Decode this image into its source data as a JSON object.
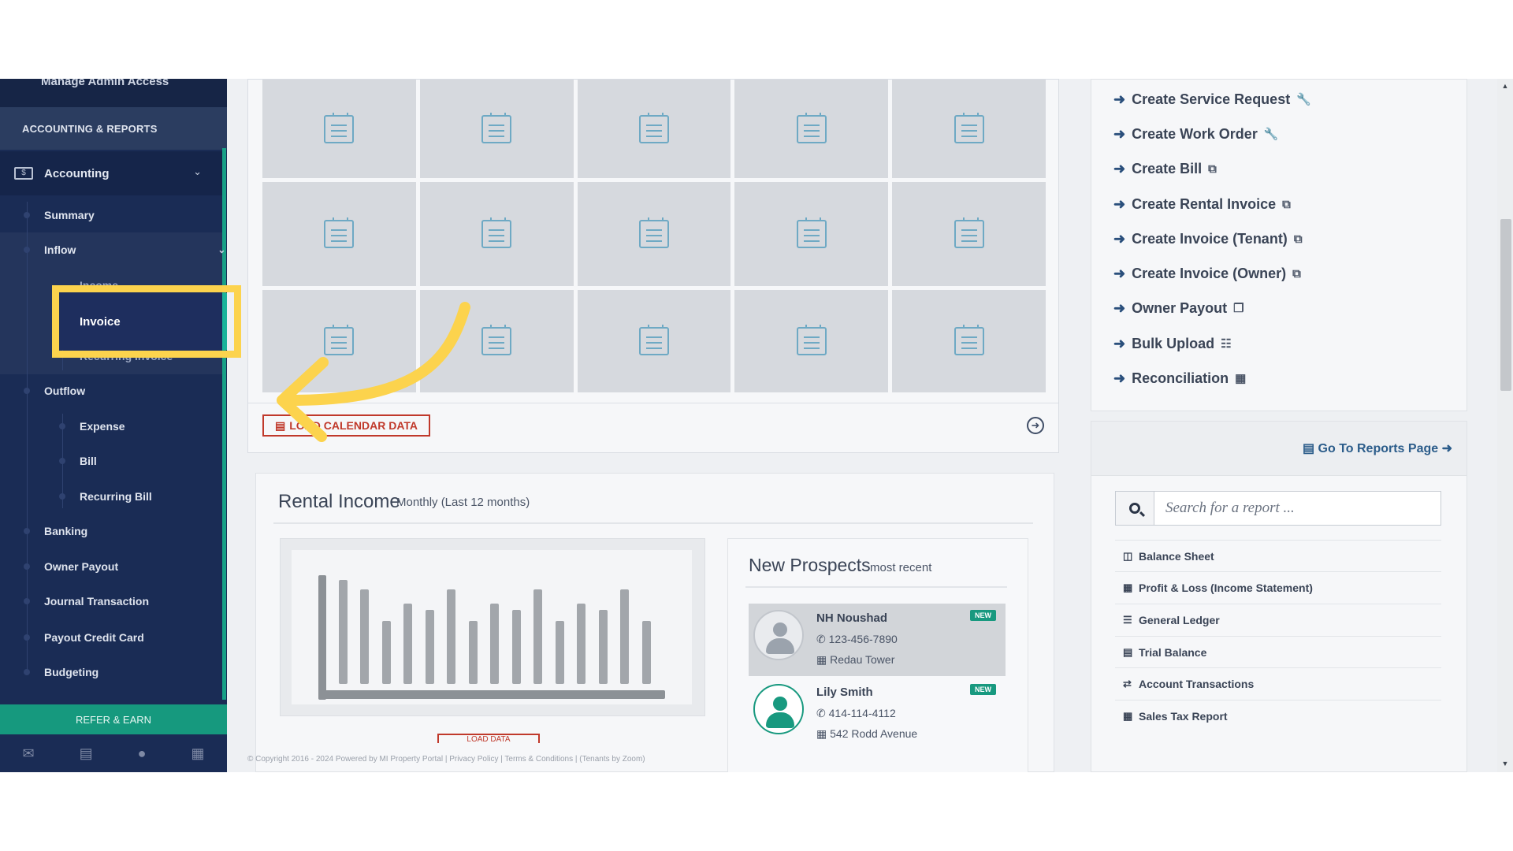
{
  "sidebar": {
    "top_item": "Manage Admin Access",
    "section_header": "ACCOUNTING & REPORTS",
    "accounting_label": "Accounting",
    "items": {
      "summary": "Summary",
      "inflow": "Inflow",
      "income": "Income",
      "invoice": "Invoice",
      "recurring_invoice": "Recurring Invoice",
      "outflow": "Outflow",
      "expense": "Expense",
      "bill": "Bill",
      "recurring_bill": "Recurring Bill",
      "banking": "Banking",
      "owner_payout": "Owner Payout",
      "journal_transaction": "Journal Transaction",
      "payout_credit_card": "Payout Credit Card",
      "budgeting": "Budgeting"
    },
    "refer_earn": "REFER & EARN",
    "footer_icons": [
      "envelope-icon",
      "briefcase-icon",
      "user-icon",
      "calculator-icon"
    ]
  },
  "calendar": {
    "load_button": "LOAD CALENDAR DATA"
  },
  "rental_income": {
    "title": "Rental Income",
    "subtitle": "Monthly (Last 12 months)",
    "load_stub": "LOAD DATA"
  },
  "prospects": {
    "title": "New Prospects",
    "subtitle": "most recent",
    "badge": "NEW",
    "list": [
      {
        "name": "NH Noushad",
        "phone": "123-456-7890",
        "address": "Redau Tower"
      },
      {
        "name": "Lily Smith",
        "phone": "414-114-4112",
        "address": "542 Rodd Avenue"
      }
    ]
  },
  "actions": {
    "create_service_request": "Create Service Request",
    "create_work_order": "Create Work Order",
    "create_bill": "Create Bill",
    "create_rental_invoice": "Create Rental Invoice",
    "create_invoice_tenant": "Create Invoice (Tenant)",
    "create_invoice_owner": "Create Invoice (Owner)",
    "owner_payout": "Owner Payout",
    "bulk_upload": "Bulk Upload",
    "reconciliation": "Reconciliation"
  },
  "reports": {
    "go_to_reports": "Go To Reports Page",
    "search_placeholder": "Search for a report ...",
    "list": {
      "balance_sheet": "Balance Sheet",
      "profit_loss": "Profit & Loss (Income Statement)",
      "general_ledger": "General Ledger",
      "trial_balance": "Trial Balance",
      "account_transactions": "Account Transactions",
      "sales_tax_report": "Sales Tax Report"
    }
  },
  "footer": {
    "copyright": "© Copyright 2016 - 2024 Powered by MI Property Portal | Privacy Policy | Terms & Conditions | (Tenants by Zoom)"
  },
  "colors": {
    "sidebar_bg": "#1a2c55",
    "accent_green": "#18a086",
    "highlight_yellow": "#fcd34d",
    "danger_red": "#c0392b"
  }
}
